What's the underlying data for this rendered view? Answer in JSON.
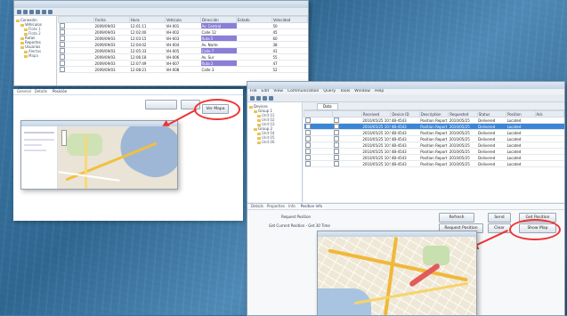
{
  "left_window": {
    "title": "",
    "tree_items": [
      {
        "label": "Conexión",
        "level": 1
      },
      {
        "label": "Vehículos",
        "level": 2
      },
      {
        "label": "Flota 1",
        "level": 3
      },
      {
        "label": "Flota 2",
        "level": 3
      },
      {
        "label": "Rutas",
        "level": 2
      },
      {
        "label": "Reportes",
        "level": 2
      },
      {
        "label": "Usuarios",
        "level": 2
      },
      {
        "label": "Alertas",
        "level": 3
      },
      {
        "label": "Mapa",
        "level": 3
      }
    ],
    "columns": [
      "",
      "Fecha",
      "Hora",
      "Vehículo",
      "Dirección",
      "Estado",
      "Velocidad"
    ],
    "rows": [
      [
        "",
        "2009/09/03",
        "12:01:11",
        "VH-001",
        "Av. Central",
        "",
        "50"
      ],
      [
        "",
        "2009/09/03",
        "12:02:40",
        "VH-002",
        "Calle 12",
        "",
        "45"
      ],
      [
        "",
        "2009/09/03",
        "12:03:15",
        "VH-003",
        "Ruta 5",
        "",
        "60"
      ],
      [
        "",
        "2009/09/03",
        "12:04:02",
        "VH-004",
        "Av. Norte",
        "",
        "38"
      ],
      [
        "",
        "2009/09/03",
        "12:05:33",
        "VH-005",
        "Calle 7",
        "",
        "41"
      ],
      [
        "",
        "2009/09/03",
        "12:06:18",
        "VH-006",
        "Av. Sur",
        "",
        "55"
      ],
      [
        "",
        "2009/09/03",
        "12:07:49",
        "VH-007",
        "Ruta 2",
        "",
        "47"
      ],
      [
        "",
        "2009/09/03",
        "12:08:21",
        "VH-008",
        "Calle 3",
        "",
        "52"
      ]
    ],
    "panel_tabs": [
      "General",
      "Detalle",
      "Posición"
    ],
    "panel_field": "",
    "buttons": [
      "",
      "",
      "Ver Mapa"
    ]
  },
  "right_window": {
    "title": "",
    "menu": [
      "File",
      "Edit",
      "View",
      "Communication",
      "Query",
      "Tools",
      "Window",
      "Help"
    ],
    "tab_label": "Data",
    "tree_items": [
      {
        "label": "Devices",
        "level": 1
      },
      {
        "label": "Group 1",
        "level": 2
      },
      {
        "label": "Unit 01",
        "level": 3
      },
      {
        "label": "Unit 02",
        "level": 3
      },
      {
        "label": "Unit 03",
        "level": 3
      },
      {
        "label": "Group 2",
        "level": 2
      },
      {
        "label": "Unit 04",
        "level": 3
      },
      {
        "label": "Unit 05",
        "level": 3
      },
      {
        "label": "Unit 06",
        "level": 3
      }
    ],
    "columns": [
      "",
      "",
      "Received",
      "Device ID",
      "Description",
      "Requested",
      "Status",
      "Position",
      "Ack"
    ],
    "rows": [
      [
        "",
        "",
        "2010/05/25 10:52:35",
        "4B-4543",
        "Position Report",
        "2010/05/25",
        "Delivered",
        "Located",
        ""
      ],
      [
        "",
        "",
        "2010/05/25 10:52:35",
        "4B-4543",
        "Position Report",
        "2010/05/25",
        "Delivered",
        "Located",
        ""
      ],
      [
        "",
        "",
        "2010/05/25 10:52:35",
        "4B-4543",
        "Position Report",
        "2010/05/25",
        "Delivered",
        "Located",
        ""
      ],
      [
        "",
        "",
        "2010/05/25 10:52:35",
        "4B-4543",
        "Position Report",
        "2010/05/25",
        "Delivered",
        "Located",
        ""
      ],
      [
        "",
        "",
        "2010/05/25 10:52:35",
        "4B-4543",
        "Position Report",
        "2010/05/25",
        "Delivered",
        "Located",
        ""
      ],
      [
        "",
        "",
        "2010/05/25 10:52:35",
        "4B-4543",
        "Position Report",
        "2010/05/25",
        "Delivered",
        "Located",
        ""
      ],
      [
        "",
        "",
        "2010/05/25 10:52:35",
        "4B-4543",
        "Position Report",
        "2010/05/25",
        "Delivered",
        "Located",
        ""
      ],
      [
        "",
        "",
        "2010/05/25 10:52:35",
        "4B-4543",
        "Position Report",
        "2010/05/25",
        "Delivered",
        "Located",
        ""
      ]
    ],
    "panel_tabs": [
      "Details",
      "Properties",
      "Info",
      "Position Info"
    ],
    "panel_fields": [
      "Request Position",
      "Get Current Position - Get 30 Time"
    ],
    "buttons": {
      "b1": "Refresh",
      "b2": "Send",
      "b3": "Get Position",
      "b4": "Request Position",
      "b5": "Clear",
      "b6": "Show Map"
    }
  },
  "colors": {
    "highlight": "#e33333",
    "selection": "#3c86d6",
    "accent_purple": "#8a7ed8"
  }
}
